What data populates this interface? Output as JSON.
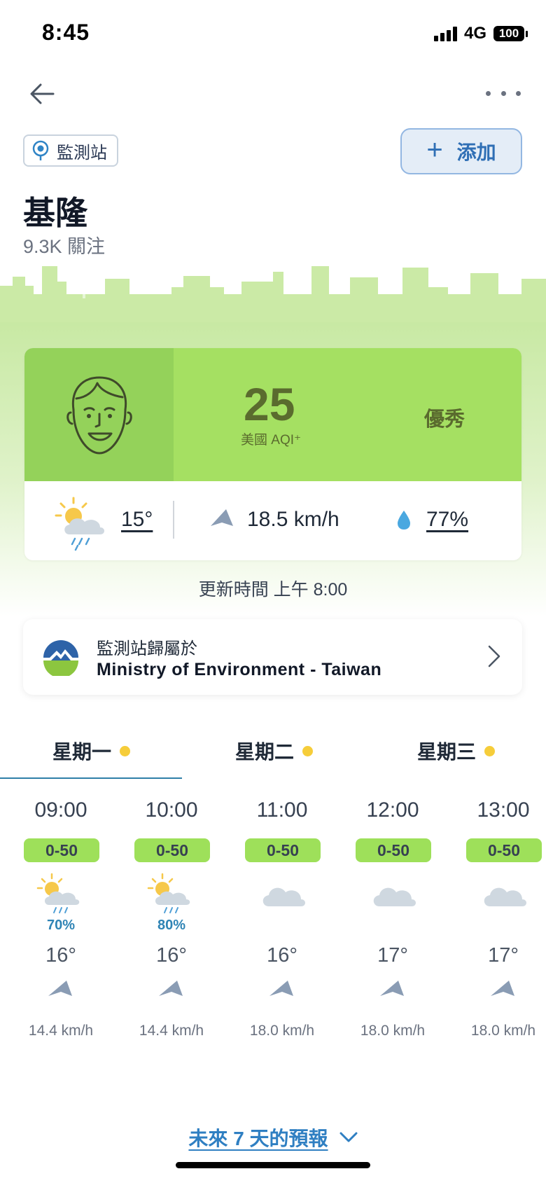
{
  "status": {
    "time": "8:45",
    "network": "4G",
    "battery": "100"
  },
  "header": {
    "chip_label": "監測站",
    "add_label": "添加"
  },
  "station": {
    "city": "基隆",
    "followers": "9.3K 關注"
  },
  "aqi": {
    "value": "25",
    "unit": "美國 AQI⁺",
    "level": "優秀",
    "temperature": "15°",
    "wind": "18.5 km/h",
    "humidity": "77%",
    "updated": "更新時間 上午 8:00"
  },
  "source": {
    "label": "監測站歸屬於",
    "org": "Ministry of Environment - Taiwan"
  },
  "tabs": [
    "星期一",
    "星期二",
    "星期三"
  ],
  "hourly": [
    {
      "time": "09:00",
      "aqi": "0-50",
      "icon": "sun-cloud-rain-icon",
      "precip": "70%",
      "temp": "16°",
      "wind": "14.4 km/h"
    },
    {
      "time": "10:00",
      "aqi": "0-50",
      "icon": "sun-cloud-rain-icon",
      "precip": "80%",
      "temp": "16°",
      "wind": "14.4 km/h"
    },
    {
      "time": "11:00",
      "aqi": "0-50",
      "icon": "cloud-icon",
      "precip": "",
      "temp": "16°",
      "wind": "18.0 km/h"
    },
    {
      "time": "12:00",
      "aqi": "0-50",
      "icon": "cloud-icon",
      "precip": "",
      "temp": "17°",
      "wind": "18.0 km/h"
    },
    {
      "time": "13:00",
      "aqi": "0-50",
      "icon": "cloud-icon",
      "precip": "",
      "temp": "17°",
      "wind": "18.0 km/h"
    }
  ],
  "footer": {
    "forecast_link": "未來 7 天的預報"
  },
  "colors": {
    "aqi_good": "#a5e062",
    "accent": "#2f7fc2"
  }
}
